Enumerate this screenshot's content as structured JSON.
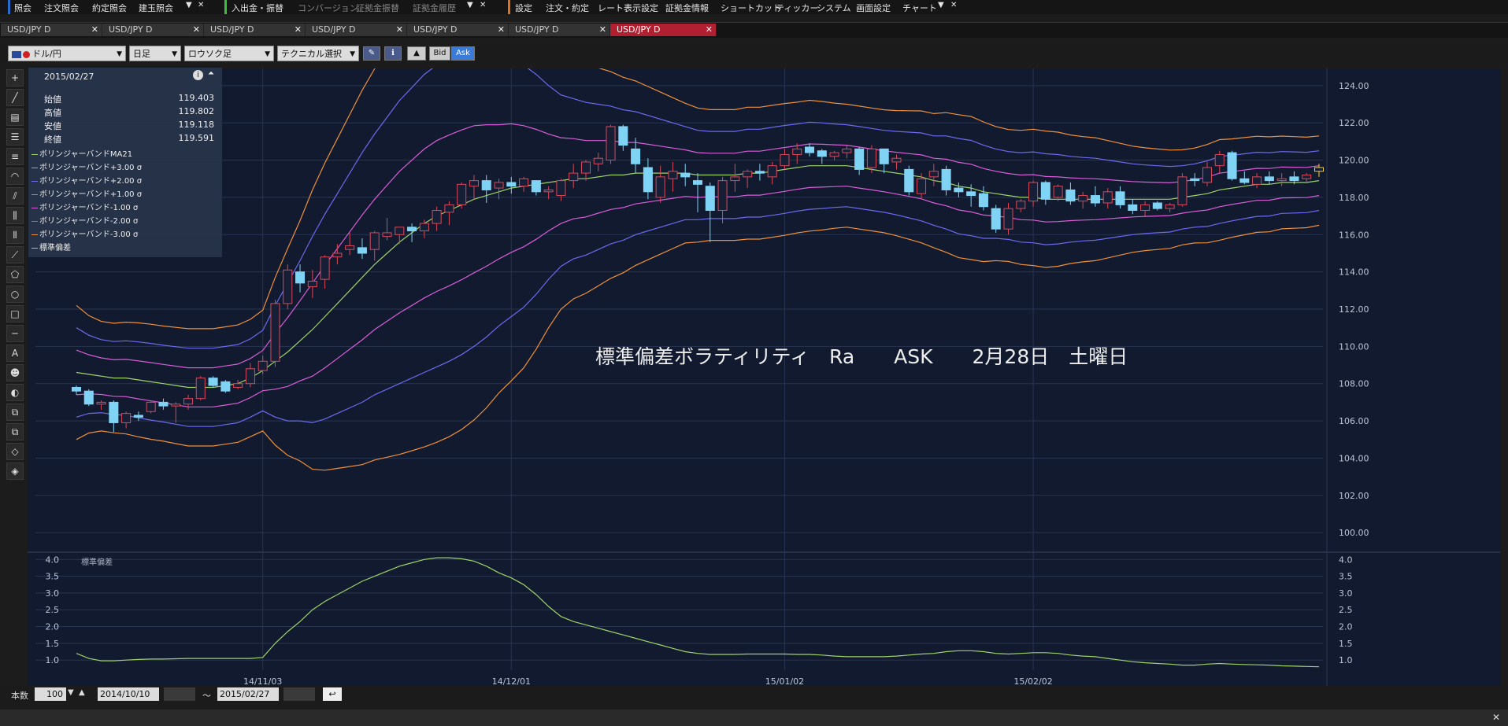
{
  "menu": {
    "g1": [
      "照会",
      "注文照会",
      "約定照会",
      "建玉照会"
    ],
    "g2": [
      "入出金・振替",
      "コンバージョン",
      "証拠金振替",
      "証拠金履歴"
    ],
    "g3": [
      "設定",
      "注文・約定",
      "レート表示設定",
      "証拠金情報",
      "ショートカット",
      "ティッカー",
      "システム",
      "画面設定",
      "チャート"
    ]
  },
  "tabs": [
    "USD/JPY D",
    "USD/JPY D",
    "USD/JPY D",
    "USD/JPY D",
    "USD/JPY D",
    "USD/JPY D",
    "USD/JPY D"
  ],
  "tabs_active_index": 6,
  "toolbar": {
    "pair": "ドル/円",
    "period": "日足",
    "chart_type": "ロウソク足",
    "technical": "テクニカル選択",
    "bid": "Bid",
    "ask": "Ask"
  },
  "ohlc": {
    "date": "2015/02/27",
    "rows": [
      {
        "label": "始値",
        "value": "119.403"
      },
      {
        "label": "高値",
        "value": "119.802"
      },
      {
        "label": "安値",
        "value": "119.118"
      },
      {
        "label": "終値",
        "value": "119.591"
      }
    ]
  },
  "legend": [
    {
      "label": "ボリンジャーバンドMA21",
      "color": "#9fd36a"
    },
    {
      "label": "ボリンジャーバンド+3.00 σ",
      "color": "#f0913a"
    },
    {
      "label": "ボリンジャーバンド+2.00 σ",
      "color": "#6d6af0"
    },
    {
      "label": "ボリンジャーバンド+1.00 σ",
      "color": "#d95ed8"
    },
    {
      "label": "ボリンジャーバンド-1.00 σ",
      "color": "#d95ed8"
    },
    {
      "label": "ボリンジャーバンド-2.00 σ",
      "color": "#6d6af0"
    },
    {
      "label": "ボリンジャーバンド-3.00 σ",
      "color": "#f0913a"
    },
    {
      "label": "標準偏差",
      "color": "#9fd36a"
    }
  ],
  "annotation": "標準偏差ボラティリティ　Ra　　ASK　　2月28日　土曜日",
  "sub_label": "標準偏差",
  "bottom": {
    "count_label": "本数",
    "count": "100",
    "from": "2014/10/10",
    "tilde": "〜",
    "to": "2015/02/27"
  },
  "chart_data": [
    {
      "type": "candlestick",
      "price_axis": [
        "124.00",
        "122.00",
        "120.00",
        "118.00",
        "116.00",
        "114.00",
        "112.00",
        "110.00",
        "108.00",
        "106.00",
        "104.00",
        "102.00",
        "100.00"
      ],
      "ylim": [
        99.5,
        124.5
      ],
      "date_ticks": [
        "14/11/03",
        "14/12/01",
        "15/01/02",
        "15/02/02"
      ],
      "date_tick_index": [
        15,
        35,
        57,
        77
      ],
      "candles": [
        [
          107.8,
          107.9,
          107.4,
          107.6
        ],
        [
          107.6,
          107.7,
          106.8,
          106.9
        ],
        [
          106.9,
          107.1,
          106.6,
          107.0
        ],
        [
          107.0,
          107.1,
          105.4,
          105.9
        ],
        [
          105.9,
          106.5,
          105.6,
          106.4
        ],
        [
          106.3,
          106.5,
          106.0,
          106.2
        ],
        [
          106.5,
          107.1,
          106.4,
          107.0
        ],
        [
          107.0,
          107.2,
          106.6,
          106.8
        ],
        [
          106.8,
          107.0,
          105.9,
          106.9
        ],
        [
          106.9,
          107.4,
          106.6,
          107.2
        ],
        [
          107.2,
          108.4,
          107.1,
          108.3
        ],
        [
          108.3,
          108.4,
          107.8,
          107.9
        ],
        [
          108.1,
          108.2,
          107.5,
          107.6
        ],
        [
          107.8,
          108.2,
          107.7,
          108.0
        ],
        [
          108.0,
          109.1,
          107.8,
          108.8
        ],
        [
          108.7,
          109.5,
          108.5,
          109.2
        ],
        [
          109.2,
          112.5,
          108.9,
          112.3
        ],
        [
          112.3,
          114.4,
          112.0,
          114.1
        ],
        [
          114.0,
          114.4,
          112.9,
          113.4
        ],
        [
          113.2,
          114.1,
          112.6,
          113.5
        ],
        [
          113.6,
          114.9,
          113.1,
          114.8
        ],
        [
          114.8,
          115.5,
          114.4,
          115.0
        ],
        [
          115.2,
          116.1,
          114.9,
          115.4
        ],
        [
          115.3,
          115.8,
          114.7,
          115.0
        ],
        [
          115.2,
          116.2,
          114.6,
          116.1
        ],
        [
          115.9,
          116.9,
          115.7,
          116.1
        ],
        [
          116.0,
          116.4,
          115.5,
          116.4
        ],
        [
          116.4,
          116.6,
          115.6,
          116.2
        ],
        [
          116.2,
          116.8,
          115.8,
          116.6
        ],
        [
          116.6,
          117.5,
          116.2,
          117.3
        ],
        [
          117.2,
          117.8,
          116.5,
          117.6
        ],
        [
          117.6,
          118.8,
          117.4,
          118.7
        ],
        [
          118.6,
          119.2,
          117.9,
          118.9
        ],
        [
          118.9,
          119.2,
          117.7,
          118.4
        ],
        [
          118.5,
          119.0,
          117.9,
          118.8
        ],
        [
          118.8,
          119.1,
          118.2,
          118.6
        ],
        [
          118.6,
          119.1,
          118.3,
          119.0
        ],
        [
          118.9,
          118.9,
          118.1,
          118.3
        ],
        [
          118.3,
          118.6,
          117.9,
          118.4
        ],
        [
          118.1,
          119.0,
          117.8,
          118.9
        ],
        [
          118.9,
          119.8,
          118.5,
          119.3
        ],
        [
          119.3,
          120.0,
          118.9,
          119.9
        ],
        [
          119.8,
          120.4,
          119.4,
          120.1
        ],
        [
          120.0,
          121.9,
          119.8,
          121.8
        ],
        [
          121.8,
          121.9,
          120.5,
          120.8
        ],
        [
          120.6,
          121.2,
          119.3,
          119.8
        ],
        [
          119.6,
          120.1,
          117.9,
          118.3
        ],
        [
          118.0,
          119.7,
          117.7,
          119.1
        ],
        [
          119.0,
          119.9,
          118.3,
          119.4
        ],
        [
          119.3,
          119.8,
          118.6,
          119.1
        ],
        [
          118.9,
          119.3,
          117.2,
          118.7
        ],
        [
          118.6,
          118.8,
          115.6,
          117.3
        ],
        [
          117.3,
          119.1,
          116.6,
          118.9
        ],
        [
          118.9,
          119.8,
          118.3,
          119.1
        ],
        [
          119.1,
          119.5,
          118.5,
          119.4
        ],
        [
          119.4,
          119.8,
          118.9,
          119.3
        ],
        [
          119.1,
          119.9,
          118.7,
          119.7
        ],
        [
          119.7,
          120.6,
          119.5,
          120.3
        ],
        [
          120.3,
          120.9,
          119.8,
          120.6
        ],
        [
          120.7,
          120.9,
          120.2,
          120.4
        ],
        [
          120.5,
          120.6,
          119.8,
          120.2
        ],
        [
          120.2,
          120.5,
          120.0,
          120.4
        ],
        [
          120.4,
          120.8,
          120.1,
          120.6
        ],
        [
          120.6,
          120.7,
          119.2,
          119.5
        ],
        [
          119.6,
          120.8,
          119.3,
          120.6
        ],
        [
          120.6,
          120.6,
          119.3,
          119.8
        ],
        [
          119.9,
          120.3,
          119.5,
          120.1
        ],
        [
          119.5,
          119.7,
          118.1,
          118.3
        ],
        [
          118.2,
          119.3,
          117.9,
          119.0
        ],
        [
          119.1,
          119.8,
          118.6,
          119.4
        ],
        [
          119.5,
          119.7,
          118.1,
          118.4
        ],
        [
          118.5,
          118.8,
          118.0,
          118.3
        ],
        [
          118.3,
          118.7,
          117.5,
          118.1
        ],
        [
          118.2,
          118.6,
          117.3,
          117.5
        ],
        [
          117.4,
          117.6,
          116.1,
          116.3
        ],
        [
          116.3,
          117.7,
          116.0,
          117.4
        ],
        [
          117.4,
          117.9,
          117.2,
          117.8
        ],
        [
          117.8,
          118.9,
          117.5,
          118.8
        ],
        [
          118.8,
          118.9,
          117.6,
          117.9
        ],
        [
          118.0,
          118.7,
          117.8,
          118.6
        ],
        [
          118.4,
          118.8,
          117.6,
          117.8
        ],
        [
          117.8,
          118.3,
          117.4,
          118.1
        ],
        [
          118.1,
          118.6,
          117.5,
          117.7
        ],
        [
          117.7,
          118.5,
          117.4,
          118.3
        ],
        [
          118.3,
          118.6,
          117.4,
          117.6
        ],
        [
          117.6,
          117.9,
          117.1,
          117.3
        ],
        [
          117.3,
          117.8,
          117.0,
          117.6
        ],
        [
          117.7,
          117.8,
          117.3,
          117.4
        ],
        [
          117.4,
          117.7,
          117.2,
          117.6
        ],
        [
          117.6,
          119.3,
          117.5,
          119.1
        ],
        [
          119.0,
          119.3,
          118.6,
          118.9
        ],
        [
          118.8,
          119.9,
          118.6,
          119.6
        ],
        [
          119.7,
          120.5,
          119.3,
          120.3
        ],
        [
          120.4,
          120.5,
          118.9,
          119.0
        ],
        [
          119.0,
          119.4,
          118.7,
          118.8
        ],
        [
          118.7,
          119.3,
          118.5,
          119.1
        ],
        [
          119.1,
          119.4,
          118.7,
          118.9
        ],
        [
          118.9,
          119.3,
          118.6,
          119.0
        ],
        [
          119.1,
          119.4,
          118.7,
          118.9
        ],
        [
          119.0,
          119.3,
          118.8,
          119.2
        ],
        [
          119.4,
          119.8,
          119.1,
          119.6
        ]
      ],
      "ma21": [
        108.6,
        108.5,
        108.4,
        108.3,
        108.3,
        108.2,
        108.1,
        108.0,
        107.9,
        107.8,
        107.8,
        107.8,
        107.9,
        108.0,
        108.3,
        108.7,
        109.2,
        109.7,
        110.3,
        110.9,
        111.6,
        112.3,
        113.0,
        113.7,
        114.4,
        115.0,
        115.6,
        116.1,
        116.6,
        117.0,
        117.3,
        117.6,
        117.9,
        118.1,
        118.3,
        118.5,
        118.6,
        118.7,
        118.8,
        118.9,
        119.0,
        119.0,
        119.1,
        119.2,
        119.2,
        119.3,
        119.3,
        119.3,
        119.3,
        119.3,
        119.2,
        119.2,
        119.2,
        119.2,
        119.3,
        119.3,
        119.4,
        119.5,
        119.6,
        119.7,
        119.7,
        119.7,
        119.7,
        119.6,
        119.5,
        119.4,
        119.3,
        119.2,
        119.1,
        118.9,
        118.8,
        118.6,
        118.5,
        118.3,
        118.2,
        118.1,
        118.0,
        118.0,
        117.9,
        117.9,
        117.9,
        117.9,
        117.9,
        117.9,
        117.9,
        117.9,
        117.9,
        117.9,
        117.9,
        118.0,
        118.1,
        118.2,
        118.4,
        118.5,
        118.6,
        118.7,
        118.7,
        118.8,
        118.8,
        118.8,
        118.9
      ],
      "stddev": [
        1.2,
        1.05,
        0.98,
        0.98,
        1.0,
        1.02,
        1.03,
        1.03,
        1.04,
        1.05,
        1.05,
        1.05,
        1.05,
        1.05,
        1.05,
        1.08,
        1.5,
        1.85,
        2.15,
        2.5,
        2.75,
        2.95,
        3.15,
        3.35,
        3.5,
        3.65,
        3.8,
        3.9,
        4.0,
        4.05,
        4.05,
        4.02,
        3.95,
        3.8,
        3.6,
        3.45,
        3.25,
        2.95,
        2.6,
        2.3,
        2.15,
        2.05,
        1.95,
        1.85,
        1.75,
        1.65,
        1.55,
        1.45,
        1.35,
        1.25,
        1.2,
        1.17,
        1.17,
        1.17,
        1.18,
        1.18,
        1.18,
        1.18,
        1.17,
        1.17,
        1.15,
        1.12,
        1.1,
        1.1,
        1.1,
        1.1,
        1.12,
        1.15,
        1.18,
        1.2,
        1.25,
        1.28,
        1.28,
        1.25,
        1.2,
        1.18,
        1.2,
        1.22,
        1.22,
        1.2,
        1.15,
        1.12,
        1.1,
        1.05,
        1.0,
        0.95,
        0.92,
        0.9,
        0.88,
        0.85,
        0.85,
        0.88,
        0.9,
        0.88,
        0.87,
        0.86,
        0.85,
        0.83,
        0.82,
        0.81,
        0.8
      ],
      "stddev_axis": [
        "4.0",
        "3.5",
        "3.0",
        "2.5",
        "2.0",
        "1.5",
        "1.0"
      ],
      "stddev_ylim": [
        0.7,
        4.1
      ]
    }
  ]
}
